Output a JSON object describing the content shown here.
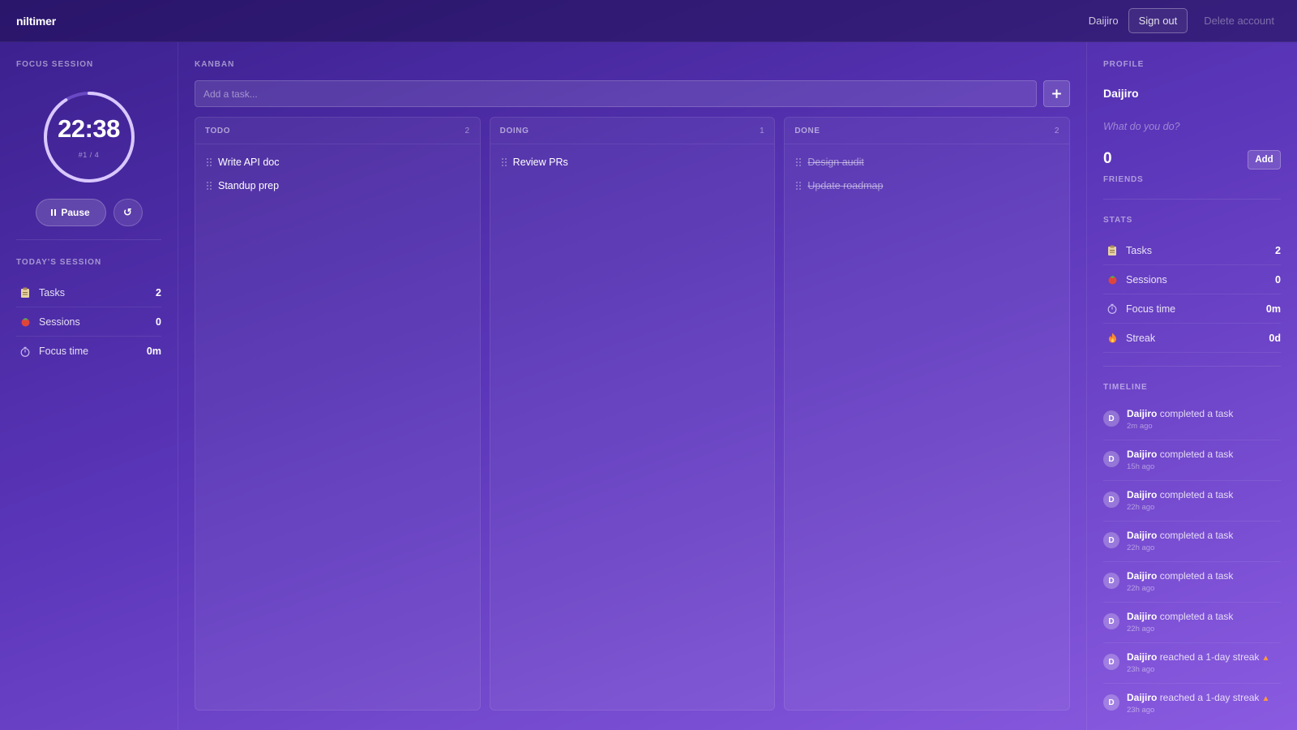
{
  "topbar": {
    "brand": "niltimer",
    "username": "Daijiro",
    "sign_out": "Sign out",
    "delete_account": "Delete account"
  },
  "focus": {
    "label": "FOCUS SESSION",
    "time": "22:38",
    "round": "#1 / 4",
    "progress": 0.91,
    "pause_label": "Pause",
    "reset_icon": "↺"
  },
  "today": {
    "label": "TODAY'S SESSION",
    "items": [
      {
        "icon": "clipboard-icon",
        "label": "Tasks",
        "value": "2"
      },
      {
        "icon": "tomato-icon",
        "label": "Sessions",
        "value": "0"
      },
      {
        "icon": "stopwatch-icon",
        "label": "Focus time",
        "value": "0m"
      }
    ]
  },
  "kanban": {
    "label": "KANBAN",
    "input_placeholder": "Add a task...",
    "add_icon": "+",
    "columns": [
      {
        "title": "TODO",
        "count": "2",
        "tasks": [
          "Write API doc",
          "Standup prep"
        ]
      },
      {
        "title": "DOING",
        "count": "1",
        "tasks": [
          "Review PRs"
        ]
      },
      {
        "title": "DONE",
        "count": "2",
        "tasks": [
          "Design audit",
          "Update roadmap"
        ]
      }
    ]
  },
  "profile": {
    "label": "PROFILE",
    "name": "Daijiro",
    "bio_placeholder": "What do you do?",
    "friends_count": "0",
    "friends_label": "FRIENDS",
    "add_label": "Add"
  },
  "stats": {
    "label": "STATS",
    "items": [
      {
        "icon": "clipboard-icon",
        "label": "Tasks",
        "value": "2"
      },
      {
        "icon": "tomato-icon",
        "label": "Sessions",
        "value": "0"
      },
      {
        "icon": "stopwatch-icon",
        "label": "Focus time",
        "value": "0m"
      },
      {
        "icon": "flame-icon",
        "label": "Streak",
        "value": "0d"
      }
    ]
  },
  "timeline": {
    "label": "TIMELINE",
    "items": [
      {
        "initial": "D",
        "user": "Daijiro",
        "action": "completed a task",
        "time": "2m ago",
        "flame": false
      },
      {
        "initial": "D",
        "user": "Daijiro",
        "action": "completed a task",
        "time": "15h ago",
        "flame": false
      },
      {
        "initial": "D",
        "user": "Daijiro",
        "action": "completed a task",
        "time": "22h ago",
        "flame": false
      },
      {
        "initial": "D",
        "user": "Daijiro",
        "action": "completed a task",
        "time": "22h ago",
        "flame": false
      },
      {
        "initial": "D",
        "user": "Daijiro",
        "action": "completed a task",
        "time": "22h ago",
        "flame": false
      },
      {
        "initial": "D",
        "user": "Daijiro",
        "action": "completed a task",
        "time": "22h ago",
        "flame": false
      },
      {
        "initial": "D",
        "user": "Daijiro",
        "action": "reached a 1-day streak",
        "time": "23h ago",
        "flame": true
      },
      {
        "initial": "D",
        "user": "Daijiro",
        "action": "reached a 1-day streak",
        "time": "23h ago",
        "flame": true
      }
    ]
  },
  "colors": {
    "ring_track": "#6a4bc4",
    "ring_fill": "#d9c8ff",
    "flame": "#ff9a3c"
  }
}
